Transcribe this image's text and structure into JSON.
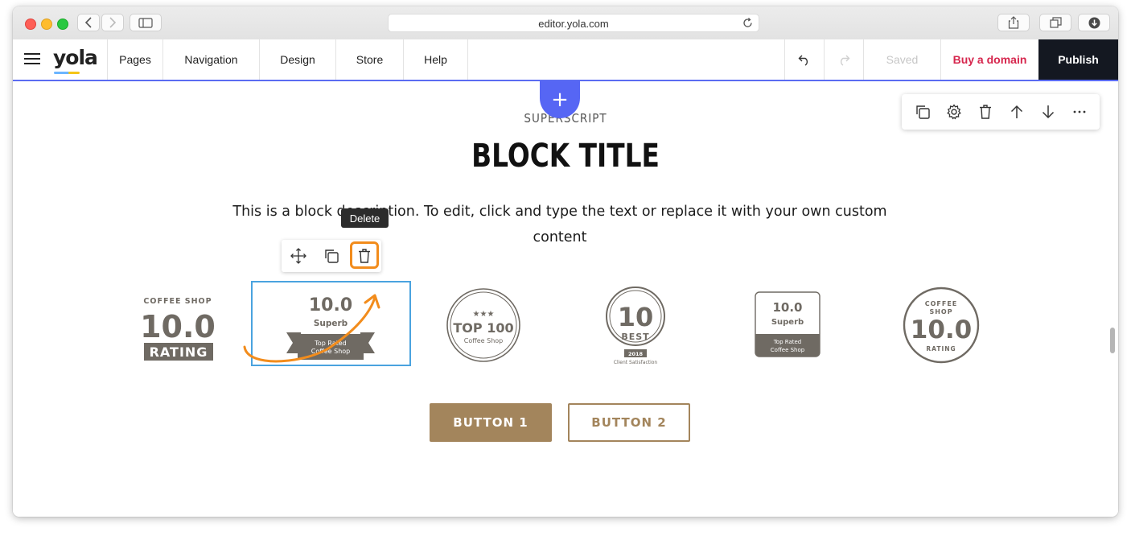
{
  "browser": {
    "url": "editor.yola.com"
  },
  "toolbar": {
    "logo": "yola",
    "nav": [
      "Pages",
      "Navigation",
      "Design",
      "Store",
      "Help"
    ],
    "saved_label": "Saved",
    "buy_domain_label": "Buy a domain",
    "publish_label": "Publish"
  },
  "block": {
    "superscript": "SUPERSCRIPT",
    "title": "BLOCK TITLE",
    "description": "This is a block description. To edit, click and type the text or replace it with your own custom content",
    "tooltip": "Delete",
    "button1": "BUTTON 1",
    "button2": "BUTTON 2"
  },
  "badges": [
    {
      "line1": "COFFEE SHOP",
      "big": "10.0",
      "line3": "RATING"
    },
    {
      "big": "10.0",
      "sub": "Superb",
      "ribbon1": "Top Rated",
      "ribbon2": "Coffee Shop"
    },
    {
      "stars": "★★★",
      "big": "TOP 100",
      "sub": "Coffee Shop"
    },
    {
      "big": "10",
      "sub": "BEST",
      "year": "2018",
      "foot": "Client Satisfaction"
    },
    {
      "big": "10.0",
      "sub": "Superb",
      "foot1": "Top Rated",
      "foot2": "Coffee Shop"
    },
    {
      "top1": "COFFEE",
      "top2": "SHOP",
      "big": "10.0",
      "sub": "RATING"
    }
  ],
  "colors": {
    "accent": "#5666f4",
    "publish_bg": "#141821",
    "buy_domain": "#d6264d",
    "brand_gold": "#a3855c",
    "badge_gray": "#6f6a63",
    "highlight": "#f28c1c",
    "selection": "#4aa3df"
  }
}
